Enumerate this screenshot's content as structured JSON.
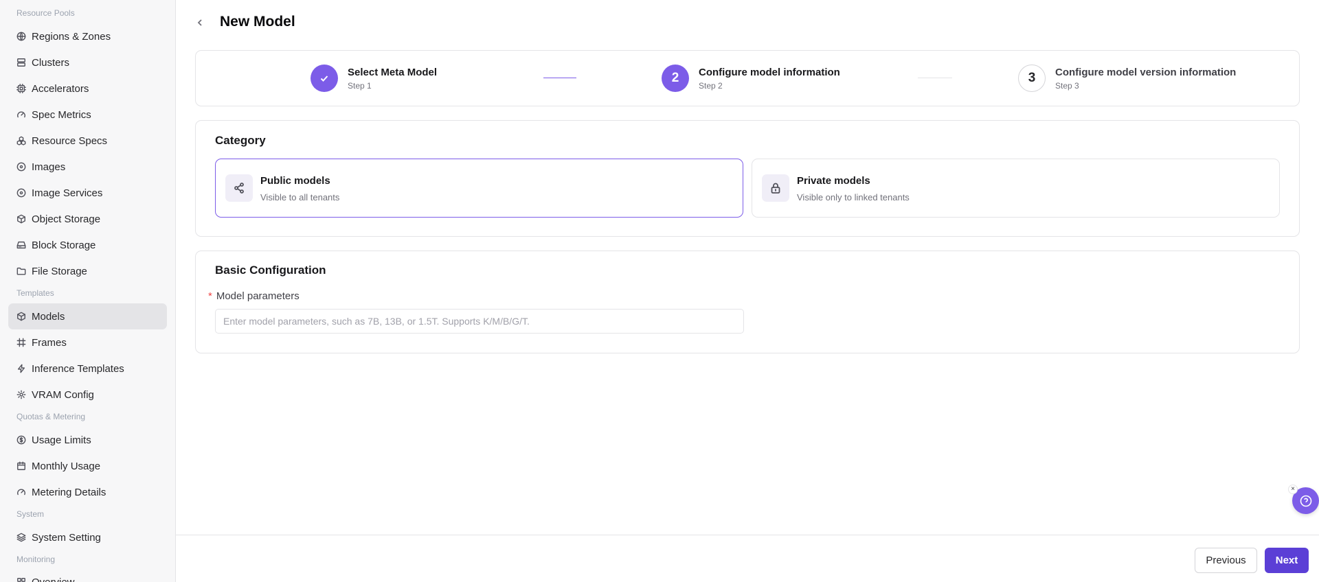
{
  "sidebar": {
    "sections": [
      {
        "label": "Resource Pools",
        "items": [
          {
            "label": "Regions & Zones",
            "icon": "globe-icon"
          },
          {
            "label": "Clusters",
            "icon": "server-icon"
          },
          {
            "label": "Accelerators",
            "icon": "cpu-icon"
          },
          {
            "label": "Spec Metrics",
            "icon": "gauge-icon"
          },
          {
            "label": "Resource Specs",
            "icon": "boxes-icon"
          },
          {
            "label": "Images",
            "icon": "disc-icon"
          },
          {
            "label": "Image Services",
            "icon": "disc-icon"
          },
          {
            "label": "Object Storage",
            "icon": "package-icon"
          },
          {
            "label": "Block Storage",
            "icon": "hard-drive-icon"
          },
          {
            "label": "File Storage",
            "icon": "folder-icon"
          }
        ]
      },
      {
        "label": "Templates",
        "items": [
          {
            "label": "Models",
            "icon": "cube-icon",
            "active": true
          },
          {
            "label": "Frames",
            "icon": "frame-icon"
          },
          {
            "label": "Inference Templates",
            "icon": "zap-icon"
          },
          {
            "label": "VRAM Config",
            "icon": "gear-icon"
          }
        ]
      },
      {
        "label": "Quotas & Metering",
        "items": [
          {
            "label": "Usage Limits",
            "icon": "dollar-circle-icon"
          },
          {
            "label": "Monthly Usage",
            "icon": "calendar-icon"
          },
          {
            "label": "Metering Details",
            "icon": "gauge-icon"
          }
        ]
      },
      {
        "label": "System",
        "items": [
          {
            "label": "System Setting",
            "icon": "layers-icon"
          }
        ]
      },
      {
        "label": "Monitoring",
        "items": [
          {
            "label": "Overview",
            "icon": "grid-icon"
          }
        ]
      }
    ]
  },
  "header": {
    "title": "New Model"
  },
  "steps": [
    {
      "title": "Select Meta Model",
      "sub": "Step 1",
      "status": "done",
      "num": ""
    },
    {
      "title": "Configure model information",
      "sub": "Step 2",
      "status": "current",
      "num": "2"
    },
    {
      "title": "Configure model version information",
      "sub": "Step 3",
      "status": "pending",
      "num": "3"
    }
  ],
  "category": {
    "title": "Category",
    "options": [
      {
        "title": "Public models",
        "sub": "Visible to all tenants",
        "icon": "share-icon",
        "selected": true
      },
      {
        "title": "Private models",
        "sub": "Visible only to linked tenants",
        "icon": "lock-icon",
        "selected": false
      }
    ]
  },
  "basic": {
    "title": "Basic Configuration",
    "required_mark": "*",
    "param_label": "Model parameters",
    "param_placeholder": "Enter model parameters, such as 7B, 13B, or 1.5T. Supports K/M/B/G/T.",
    "param_value": ""
  },
  "footer": {
    "previous": "Previous",
    "next": "Next"
  },
  "help": {
    "close": "×"
  },
  "colors": {
    "accent": "#7c5ce8",
    "primary_button": "#5b3fd6",
    "required": "#ef4444"
  }
}
